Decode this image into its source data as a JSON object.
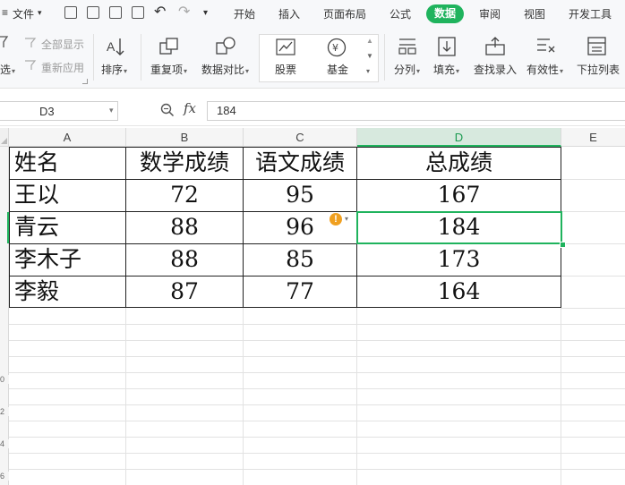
{
  "menubar": {
    "file": "文件",
    "tabs": [
      "开始",
      "插入",
      "页面布局",
      "公式",
      "数据",
      "审阅",
      "视图",
      "开发工具"
    ],
    "active_tab": "数据"
  },
  "ribbon": {
    "show_all": "全部显示",
    "reapply": "重新应用",
    "filter_fragment": "选",
    "sort": "排序",
    "duplicates": "重复项",
    "compare": "数据对比",
    "stock": "股票",
    "fund": "基金",
    "split": "分列",
    "fill": "填充",
    "lookup": "查找录入",
    "validity": "有效性",
    "dropdown": "下拉列表"
  },
  "formula_bar": {
    "cell_ref": "D3",
    "fx": "fx",
    "value": "184"
  },
  "columns": [
    "A",
    "B",
    "C",
    "D",
    "E"
  ],
  "selected_column": "D",
  "table": {
    "header": [
      "姓名",
      "数学成绩",
      "语文成绩",
      "总成绩"
    ],
    "rows": [
      [
        "王以",
        "72",
        "95",
        "167"
      ],
      [
        "青云",
        "88",
        "96",
        "184"
      ],
      [
        "李木子",
        "88",
        "85",
        "173"
      ],
      [
        "李毅",
        "87",
        "77",
        "164"
      ]
    ]
  },
  "colors": {
    "accent": "#1fb35d",
    "warning": "#f0a020"
  },
  "icons": [
    "undo-icon",
    "redo-icon",
    "search-icon",
    "warning-icon"
  ]
}
